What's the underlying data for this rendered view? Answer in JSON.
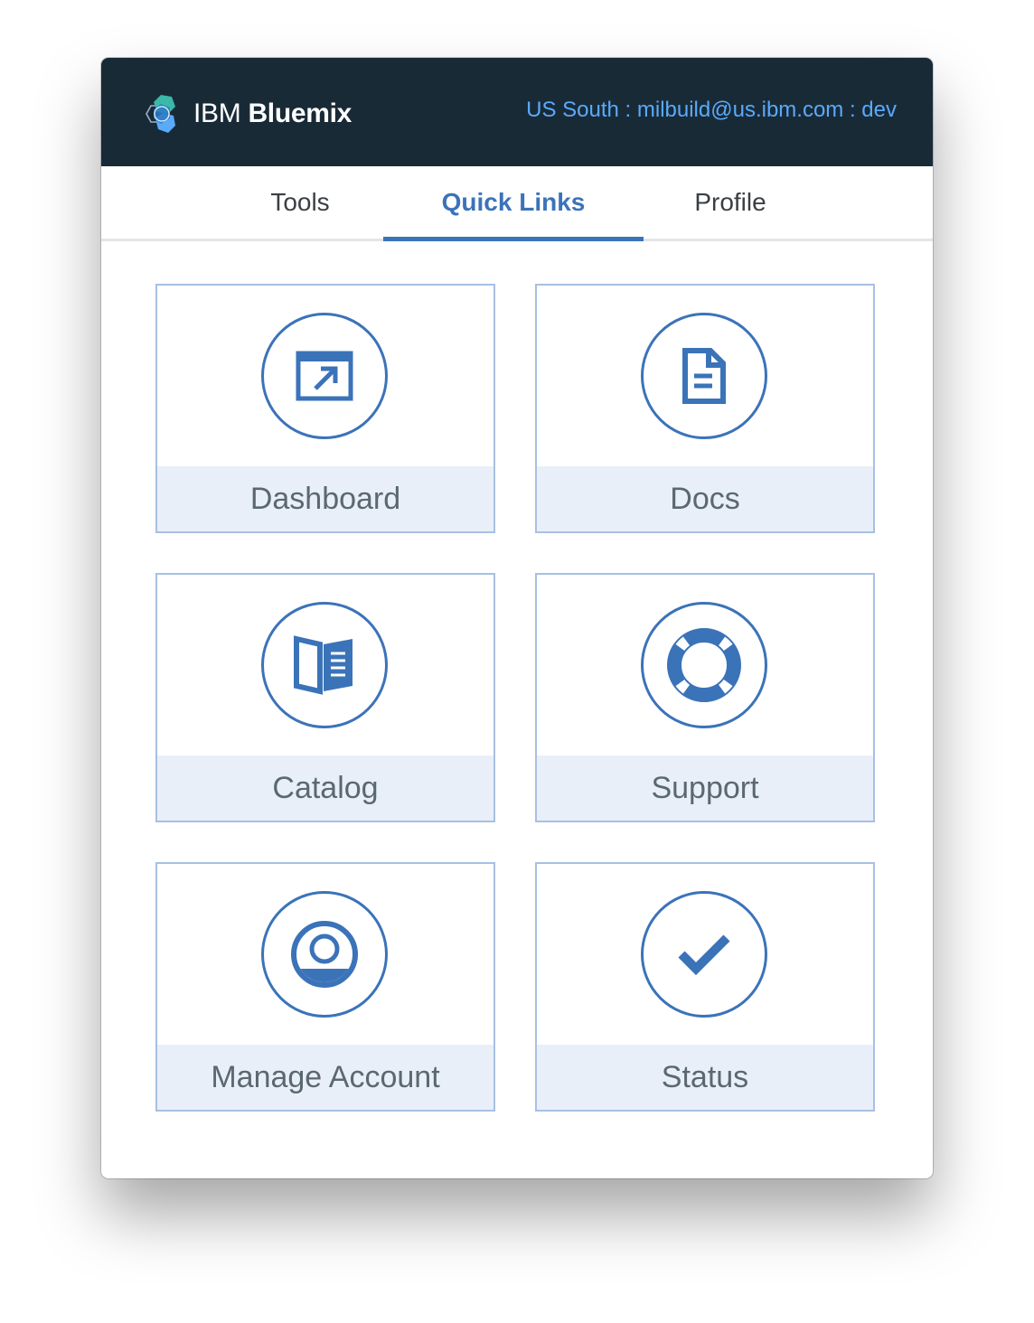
{
  "header": {
    "brand_prefix": "IBM",
    "brand_name": "Bluemix",
    "account_info": "US South : milbuild@us.ibm.com : dev"
  },
  "tabs": [
    {
      "label": "Tools",
      "active": false
    },
    {
      "label": "Quick Links",
      "active": true
    },
    {
      "label": "Profile",
      "active": false
    }
  ],
  "quick_links": [
    {
      "label": "Dashboard",
      "icon": "dashboard-icon"
    },
    {
      "label": "Docs",
      "icon": "document-icon"
    },
    {
      "label": "Catalog",
      "icon": "open-book-icon"
    },
    {
      "label": "Support",
      "icon": "lifebuoy-icon"
    },
    {
      "label": "Manage Account",
      "icon": "user-icon"
    },
    {
      "label": "Status",
      "icon": "checkmark-icon"
    }
  ],
  "colors": {
    "header_bg": "#192a37",
    "accent": "#3b73b9",
    "account_text": "#5aaafa",
    "card_border": "#a8c0e3",
    "card_label_bg": "#e9eff8",
    "card_label_text": "#5a6872"
  }
}
